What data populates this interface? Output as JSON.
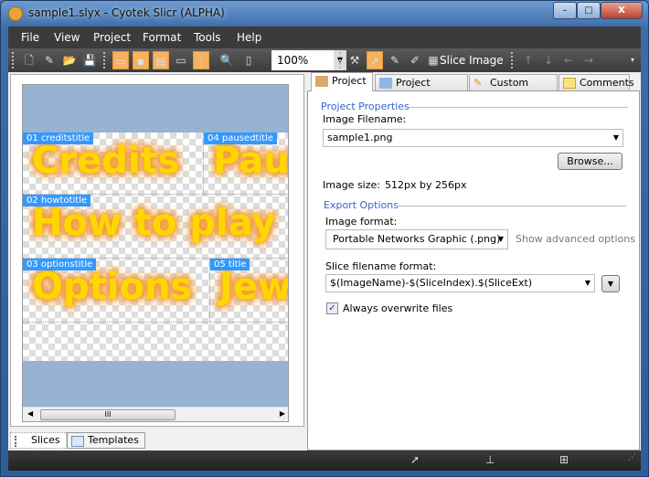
{
  "window": {
    "title": "sample1.slyx - Cyotek Slicr (ALPHA)",
    "minimize": "–",
    "maximize": "□",
    "close": "X"
  },
  "menu": [
    "File",
    "View",
    "Project",
    "Format",
    "Tools",
    "Help"
  ],
  "toolbar": {
    "zoom": "100%",
    "slice_image": "Slice Image"
  },
  "canvas": {
    "slices": [
      {
        "label": "01 creditstitle",
        "text": "Credits"
      },
      {
        "label": "04 pausedtitle",
        "text": "Paused"
      },
      {
        "label": "02 howtotitle",
        "text": "How to play"
      },
      {
        "label": "03 optionstitle",
        "text": "Options"
      },
      {
        "label": "05 title",
        "text": "Jewels"
      }
    ],
    "scroll_thumb": "III"
  },
  "left_tabs": {
    "slices": "Slices",
    "templates": "Templates"
  },
  "right_tabs": [
    "Project",
    "Project Explorer",
    "Custom Fields",
    "Comments"
  ],
  "project": {
    "properties_heading": "Project Properties",
    "image_filename_label": "Image Filename:",
    "image_filename": "sample1.png",
    "browse": "Browse...",
    "image_size_label": "Image size:",
    "image_size": "512px by 256px",
    "export_heading": "Export Options",
    "image_format_label": "Image format:",
    "image_format": "Portable Networks Graphic (.png)",
    "advanced": "Show advanced options",
    "slice_format_label": "Slice filename format:",
    "slice_format": "$(ImageName)-$(SliceIndex).$(SliceExt)",
    "overwrite_label": "Always overwrite files",
    "overwrite_checked": true
  },
  "colors": {
    "canvas_bg": "#97b3d2",
    "slice_label": "#3399ff",
    "group_heading": "#3366cc",
    "toolbar_active": "#f8b15e"
  }
}
